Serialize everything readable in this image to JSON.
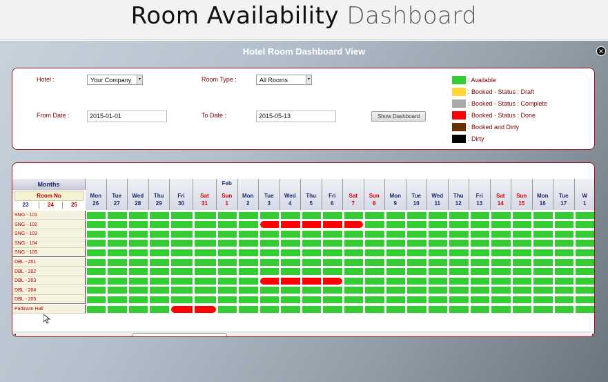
{
  "banner": {
    "title_main": "Room Availability",
    "title_light": "Dashboard"
  },
  "dashboard": {
    "title": "Hotel Room Dashboard View",
    "close_icon": "×",
    "filters": {
      "hotel_label": "Hotel :",
      "hotel_value": "Your Company",
      "room_type_label": "Room Type :",
      "room_type_value": "All Rooms",
      "from_label": "From Date :",
      "from_value": "2015-01-01",
      "to_label": "To Date :",
      "to_value": "2015-05-13",
      "show_button": "Show Dashboard"
    },
    "legend": [
      {
        "label": ": Available",
        "color": "#33cc33"
      },
      {
        "label": ": Booked - Status : Draft",
        "color": "#ffd633"
      },
      {
        "label": ": Booked - Status : Complete",
        "color": "#aaaaaa"
      },
      {
        "label": ": Booked - Status : Done",
        "color": "#ff0000"
      },
      {
        "label": ": Booked and Dirty",
        "color": "#663300"
      },
      {
        "label": ": Dirty",
        "color": "#000000"
      }
    ]
  },
  "grid": {
    "months_label": "Months",
    "month_feb": "Feb",
    "room_no_label": "Room No",
    "corner_days": [
      "23",
      "24",
      "25"
    ],
    "columns": [
      {
        "day": "Mon",
        "date": "26",
        "weekend": false
      },
      {
        "day": "Tue",
        "date": "27",
        "weekend": false
      },
      {
        "day": "Wed",
        "date": "28",
        "weekend": false
      },
      {
        "day": "Thu",
        "date": "29",
        "weekend": false
      },
      {
        "day": "Fri",
        "date": "30",
        "weekend": false
      },
      {
        "day": "Sat",
        "date": "31",
        "weekend": true
      },
      {
        "day": "Sun",
        "date": "1",
        "weekend": true
      },
      {
        "day": "Mon",
        "date": "2",
        "weekend": false
      },
      {
        "day": "Tue",
        "date": "3",
        "weekend": false
      },
      {
        "day": "Wed",
        "date": "4",
        "weekend": false
      },
      {
        "day": "Thu",
        "date": "5",
        "weekend": false
      },
      {
        "day": "Fri",
        "date": "6",
        "weekend": false
      },
      {
        "day": "Sat",
        "date": "7",
        "weekend": true
      },
      {
        "day": "Sun",
        "date": "8",
        "weekend": true
      },
      {
        "day": "Mon",
        "date": "9",
        "weekend": false
      },
      {
        "day": "Tue",
        "date": "10",
        "weekend": false
      },
      {
        "day": "Wed",
        "date": "11",
        "weekend": false
      },
      {
        "day": "Thu",
        "date": "12",
        "weekend": false
      },
      {
        "day": "Fri",
        "date": "13",
        "weekend": false
      },
      {
        "day": "Sat",
        "date": "14",
        "weekend": true
      },
      {
        "day": "Sun",
        "date": "15",
        "weekend": true
      },
      {
        "day": "Mon",
        "date": "16",
        "weekend": false
      },
      {
        "day": "Tue",
        "date": "17",
        "weekend": false
      },
      {
        "day": "W",
        "date": "1",
        "weekend": false
      }
    ],
    "rooms": [
      {
        "name": "SNG - 101",
        "done": []
      },
      {
        "name": "SNG - 102",
        "done": [
          8,
          9,
          10,
          11,
          12
        ]
      },
      {
        "name": "SNG - 103",
        "done": []
      },
      {
        "name": "SNG - 104",
        "done": []
      },
      {
        "name": "SNG - 105",
        "done": []
      },
      {
        "name": "DBL - 201",
        "done": []
      },
      {
        "name": "DBL - 202",
        "done": []
      },
      {
        "name": "DBL - 203",
        "done": [
          8,
          9,
          10,
          11
        ]
      },
      {
        "name": "DBL - 204",
        "done": []
      },
      {
        "name": "DBL - 205",
        "done": []
      },
      {
        "name": "Pattinum Hall",
        "done": [
          4,
          5
        ]
      }
    ],
    "scroll_mark": "|||"
  }
}
